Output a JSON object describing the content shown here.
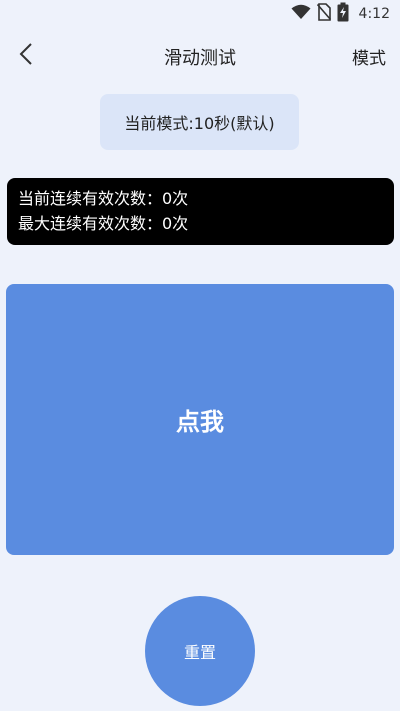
{
  "status_bar": {
    "time": "4:12",
    "icons": [
      "wifi-icon",
      "no-sim-icon",
      "battery-charging-icon"
    ]
  },
  "app_bar": {
    "back_icon": "chevron-left-icon",
    "title": "滑动测试",
    "mode_label": "模式"
  },
  "mode_badge": {
    "text": "当前模式:10秒(默认)"
  },
  "stats": {
    "current_streak": "当前连续有效次数：0次",
    "max_streak": "最大连续有效次数：0次"
  },
  "tap_area": {
    "label": "点我"
  },
  "reset": {
    "label": "重置"
  },
  "colors": {
    "background": "#eef2fb",
    "accent": "#5a8ce0",
    "badge_bg": "#dbe5f8",
    "stats_bg": "#000000"
  }
}
